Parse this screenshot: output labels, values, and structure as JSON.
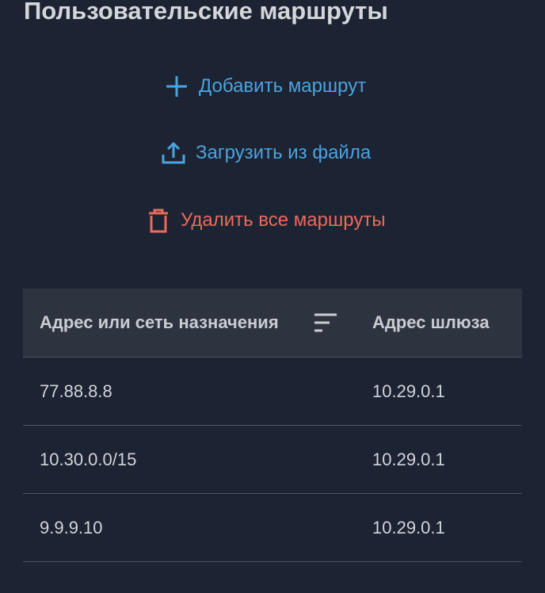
{
  "page": {
    "title": "Пользовательские маршруты"
  },
  "actions": {
    "add_route": {
      "label": "Добавить маршрут",
      "icon": "plus-icon",
      "color": "#4ca3de"
    },
    "upload_file": {
      "label": "Загрузить из файла",
      "icon": "upload-icon",
      "color": "#4ca3de"
    },
    "delete_all": {
      "label": "Удалить все маршруты",
      "icon": "trash-icon",
      "color": "#ec6a5b"
    }
  },
  "table": {
    "columns": [
      {
        "label": "Адрес или сеть назначения",
        "sort_icon": "sort-icon"
      },
      {
        "label": "Адрес шлюза"
      }
    ],
    "rows": [
      {
        "destination": "77.88.8.8",
        "gateway": "10.29.0.1"
      },
      {
        "destination": "10.30.0.0/15",
        "gateway": "10.29.0.1"
      },
      {
        "destination": "9.9.9.10",
        "gateway": "10.29.0.1"
      }
    ]
  },
  "colors": {
    "background": "#1c2333",
    "header_background": "#2d3440",
    "accent": "#4ca3de",
    "danger": "#ec6a5b"
  }
}
